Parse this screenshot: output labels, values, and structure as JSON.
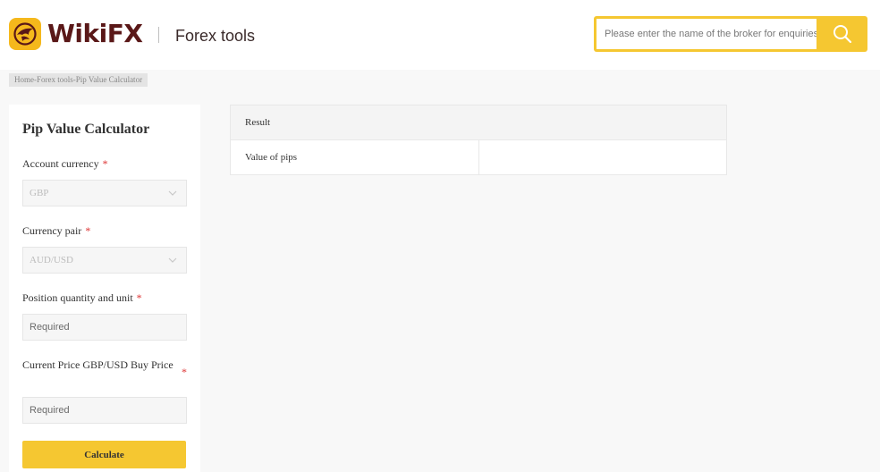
{
  "header": {
    "logo_text": "WikiFX",
    "logo_subtitle": "Forex tools",
    "search_placeholder": "Please enter the name of the broker for enquiries",
    "brand_color": "#f5c731",
    "logo_text_color": "#5a1818",
    "icons": {
      "logo": "eagle-logo-icon",
      "search": "search-icon"
    }
  },
  "breadcrumb": "Home-Forex tools-Pip Value Calculator",
  "calculator": {
    "title": "Pip Value Calculator",
    "required_mark": "*",
    "account_currency": {
      "label": "Account currency",
      "value": "GBP"
    },
    "currency_pair": {
      "label": "Currency pair",
      "value": "AUD/USD"
    },
    "position_quantity": {
      "label": "Position quantity and unit",
      "placeholder": "Required",
      "value": ""
    },
    "current_price": {
      "label": "Current Price GBP/USD Buy Price",
      "placeholder": "Required",
      "value": ""
    },
    "calculate_label": "Calculate",
    "icons": {
      "dropdown": "chevron-down-icon"
    }
  },
  "result": {
    "header": "Result",
    "rows": [
      {
        "label": "Value of pips",
        "value": ""
      }
    ]
  }
}
